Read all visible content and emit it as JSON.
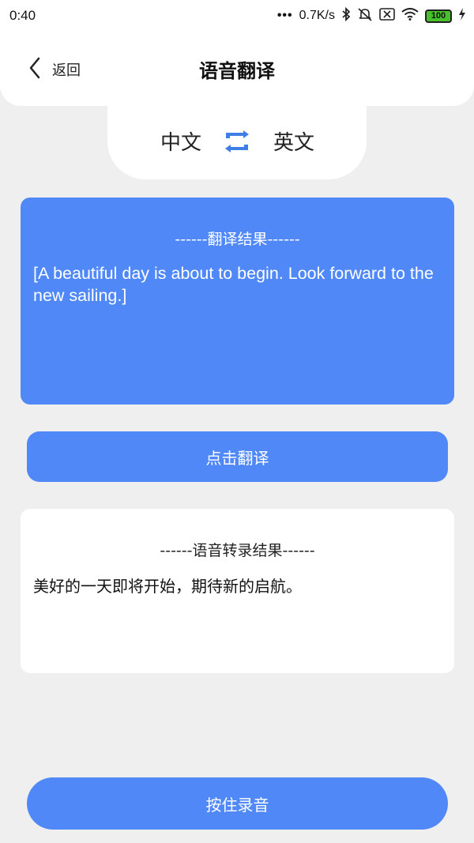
{
  "statusbar": {
    "time": "0:40",
    "dots": "•••",
    "speed": "0.7K/s",
    "battery": "100"
  },
  "header": {
    "back_label": "返回",
    "title": "语音翻译"
  },
  "language": {
    "source": "中文",
    "target": "英文"
  },
  "translation": {
    "title": "------翻译结果------",
    "text": "[A beautiful day is about to begin. Look forward to the new sailing.]"
  },
  "translate_button": "点击翻译",
  "transcription": {
    "title": "------语音转录结果------",
    "text": "美好的一天即将开始，期待新的启航。"
  },
  "record_button": "按住录音",
  "colors": {
    "accent": "#5089f7",
    "background": "#efefef",
    "card": "#ffffff"
  },
  "icons": [
    "bluetooth-icon",
    "mute-icon",
    "sim-off-icon",
    "wifi-icon",
    "battery-icon",
    "charging-icon",
    "back-arrow-icon",
    "swap-icon"
  ]
}
